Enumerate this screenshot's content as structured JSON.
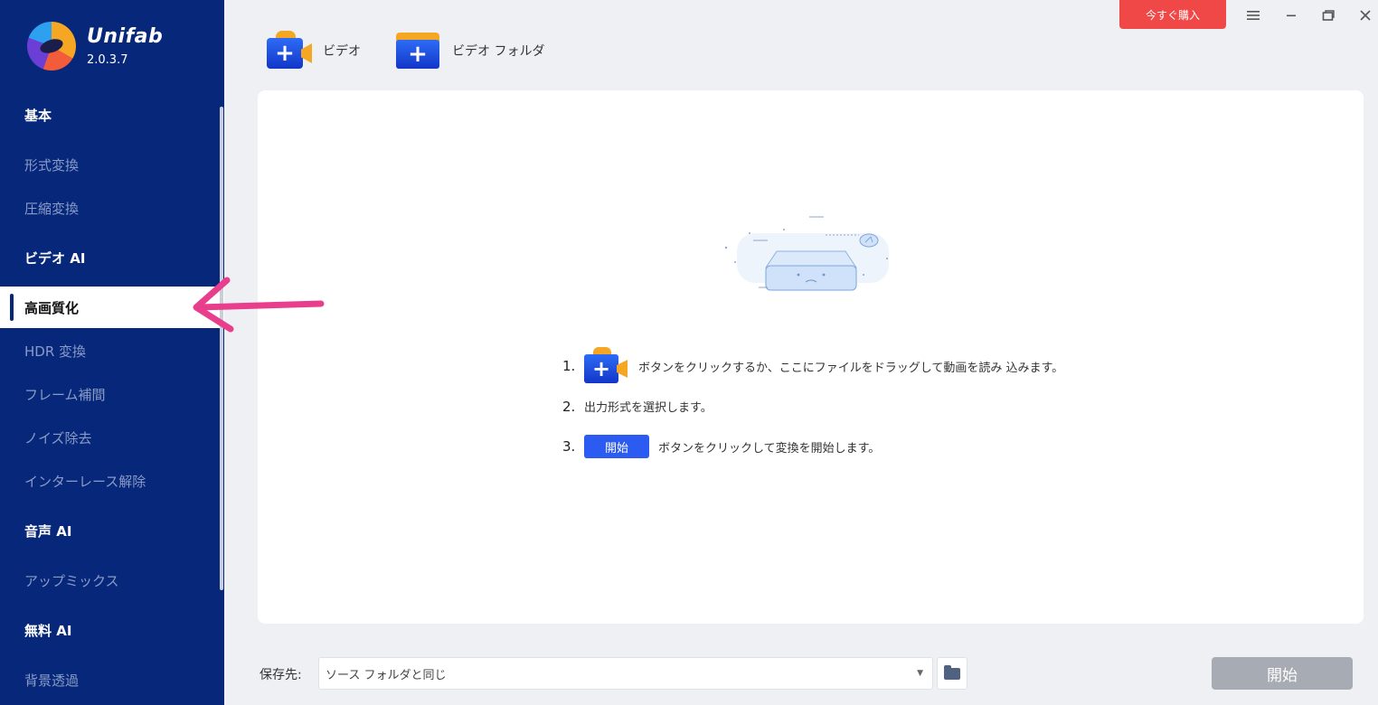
{
  "app": {
    "name": "Unifab",
    "version": "2.0.3.7"
  },
  "sidebar": {
    "items": [
      {
        "label": "基本",
        "type": "section"
      },
      {
        "label": "形式変換",
        "type": "item"
      },
      {
        "label": "圧縮変換",
        "type": "item"
      },
      {
        "label": "ビデオ AI",
        "type": "section"
      },
      {
        "label": "高画質化",
        "type": "item",
        "active": true
      },
      {
        "label": "HDR 変換",
        "type": "item"
      },
      {
        "label": "フレーム補間",
        "type": "item"
      },
      {
        "label": "ノイズ除去",
        "type": "item"
      },
      {
        "label": "インターレース解除",
        "type": "item"
      },
      {
        "label": "音声 AI",
        "type": "section"
      },
      {
        "label": "アップミックス",
        "type": "item"
      },
      {
        "label": "無料 AI",
        "type": "section"
      },
      {
        "label": "背景透過",
        "type": "item"
      }
    ]
  },
  "header": {
    "buy_label": "今すぐ購入",
    "window_icons": [
      "menu-icon",
      "minimize-icon",
      "restore-icon",
      "close-icon"
    ]
  },
  "toolbar": {
    "add_video_label": "ビデオ",
    "add_folder_label": "ビデオ フォルダ"
  },
  "main": {
    "steps": [
      {
        "num": "1.",
        "text": "ボタンをクリックするか、ここにファイルをドラッグして動画を読み 込みます。"
      },
      {
        "num": "2.",
        "text": "出力形式を選択します。"
      },
      {
        "num": "3.",
        "chip": "開始",
        "text": "ボタンをクリックして変換を開始します。"
      }
    ]
  },
  "footer": {
    "save_label": "保存先:",
    "save_value": "ソース フォルダと同じ",
    "start_label": "開始"
  },
  "colors": {
    "sidebar_bg": "#07287a",
    "buy_btn": "#f04747",
    "accent_blue": "#2b5bf0",
    "annotation": "#e83e8c"
  }
}
